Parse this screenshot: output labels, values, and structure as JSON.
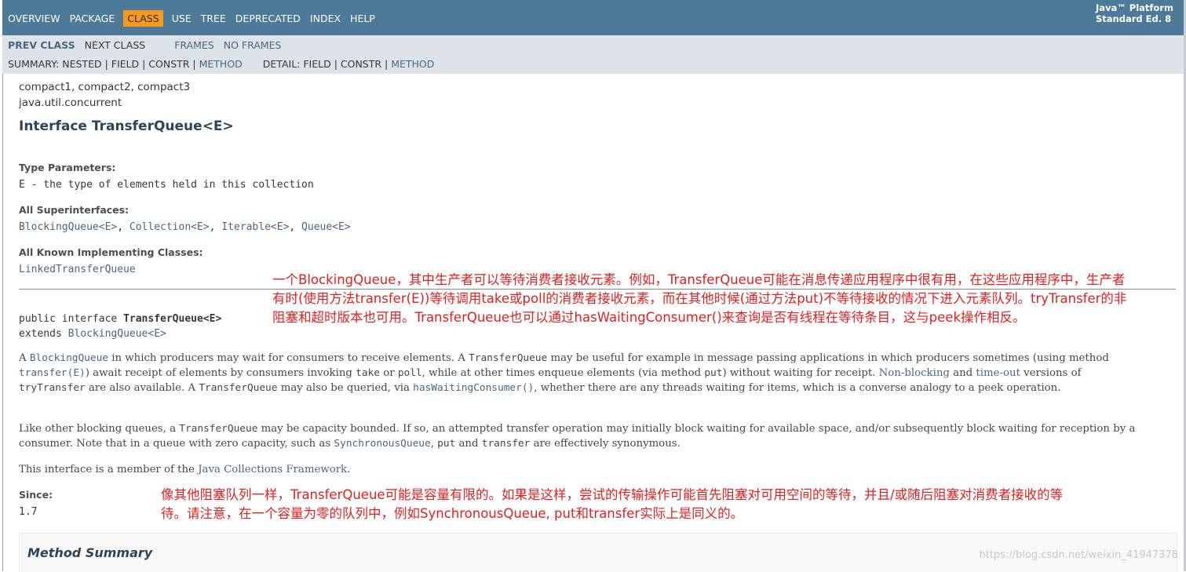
{
  "nav": {
    "top_items": [
      "OVERVIEW",
      "PACKAGE",
      "CLASS",
      "USE",
      "TREE",
      "DEPRECATED",
      "INDEX",
      "HELP"
    ],
    "active_index": 2,
    "platform_line1": "Java™ Platform",
    "platform_line2": "Standard Ed. 8",
    "prev_class": "PREV CLASS",
    "next_class": "NEXT CLASS",
    "frames": "FRAMES",
    "no_frames": "NO FRAMES",
    "summary_label": "SUMMARY: NESTED | FIELD | CONSTR | ",
    "summary_method": "METHOD",
    "detail_label": "DETAIL: FIELD | CONSTR | ",
    "detail_method": "METHOD"
  },
  "header": {
    "profiles": "compact1, compact2, compact3",
    "package": "java.util.concurrent",
    "title": "Interface TransferQueue<E>"
  },
  "type_params": {
    "label": "Type Parameters:",
    "value": "E - the type of elements held in this collection"
  },
  "superinterfaces": {
    "label": "All Superinterfaces:",
    "items": [
      "BlockingQueue<E>",
      "Collection<E>",
      "Iterable<E>",
      "Queue<E>"
    ],
    "sep": ", "
  },
  "impl_classes": {
    "label": "All Known Implementing Classes:",
    "value": "LinkedTransferQueue"
  },
  "signature": {
    "prefix": "public interface ",
    "name": "TransferQueue<E>",
    "extends": "extends ",
    "parent": "BlockingQueue<E>"
  },
  "desc": {
    "p1": {
      "t1": "A ",
      "l1": "BlockingQueue",
      "t2": " in which producers may wait for consumers to receive elements. A ",
      "c1": "TransferQueue",
      "t3": " may be useful for example in message passing applications in which producers sometimes (using method ",
      "l2": "transfer(E)",
      "t4": ") await receipt of elements by consumers invoking ",
      "c2": "take",
      "t5": " or ",
      "c3": "poll",
      "t6": ", while at other times enqueue elements (via method ",
      "c4": "put",
      "t7": ") without waiting for receipt. ",
      "l3": "Non-blocking",
      "t8": " and ",
      "l4": "time-out",
      "t9": " versions of ",
      "c5": "tryTransfer",
      "t10": " are also available. A ",
      "c6": "TransferQueue",
      "t11": " may also be queried, via ",
      "l5": "hasWaitingConsumer()",
      "t12": ", whether there are any threads waiting for items, which is a converse analogy to a peek operation."
    },
    "p2": {
      "t1": "Like other blocking queues, a ",
      "c1": "TransferQueue",
      "t2": " may be capacity bounded. If so, an attempted transfer operation may initially block waiting for available space, and/or subsequently block waiting for reception by a consumer. Note that in a queue with zero capacity, such as ",
      "l1": "SynchronousQueue",
      "t3": ", ",
      "c2": "put",
      "t4": " and ",
      "c3": "transfer",
      "t5": " are effectively synonymous."
    },
    "p3": {
      "t1": "This interface is a member of the ",
      "l1": "Java Collections Framework",
      "t2": "."
    }
  },
  "since": {
    "label": "Since:",
    "value": "1.7"
  },
  "method_summary": "Method Summary",
  "annotation1": "一个BlockingQueue，其中生产者可以等待消费者接收元素。例如，TransferQueue可能在消息传递应用程序中很有用，在这些应用程序中，生产者有时(使用方法transfer(E))等待调用take或poll的消费者接收元素，而在其他时候(通过方法put)不等待接收的情况下进入元素队列。tryTransfer的非阻塞和超时版本也可用。TransferQueue也可以通过hasWaitingConsumer()来查询是否有线程在等待条目，这与peek操作相反。",
  "annotation2": "像其他阻塞队列一样，TransferQueue可能是容量有限的。如果是这样，尝试的传输操作可能首先阻塞对可用空间的等待，并且/或随后阻塞对消费者接收的等待。请注意，在一个容量为零的队列中，例如SynchronousQueue, put和transfer实际上是同义的。",
  "watermark": "https://blog.csdn.net/weixin_41947378",
  "colors": {
    "nav_bg": "#4d7a97",
    "active_bg": "#f8981d",
    "subnav_bg": "#dee3e9",
    "link": "#4a6782",
    "annotation": "#e02020"
  }
}
